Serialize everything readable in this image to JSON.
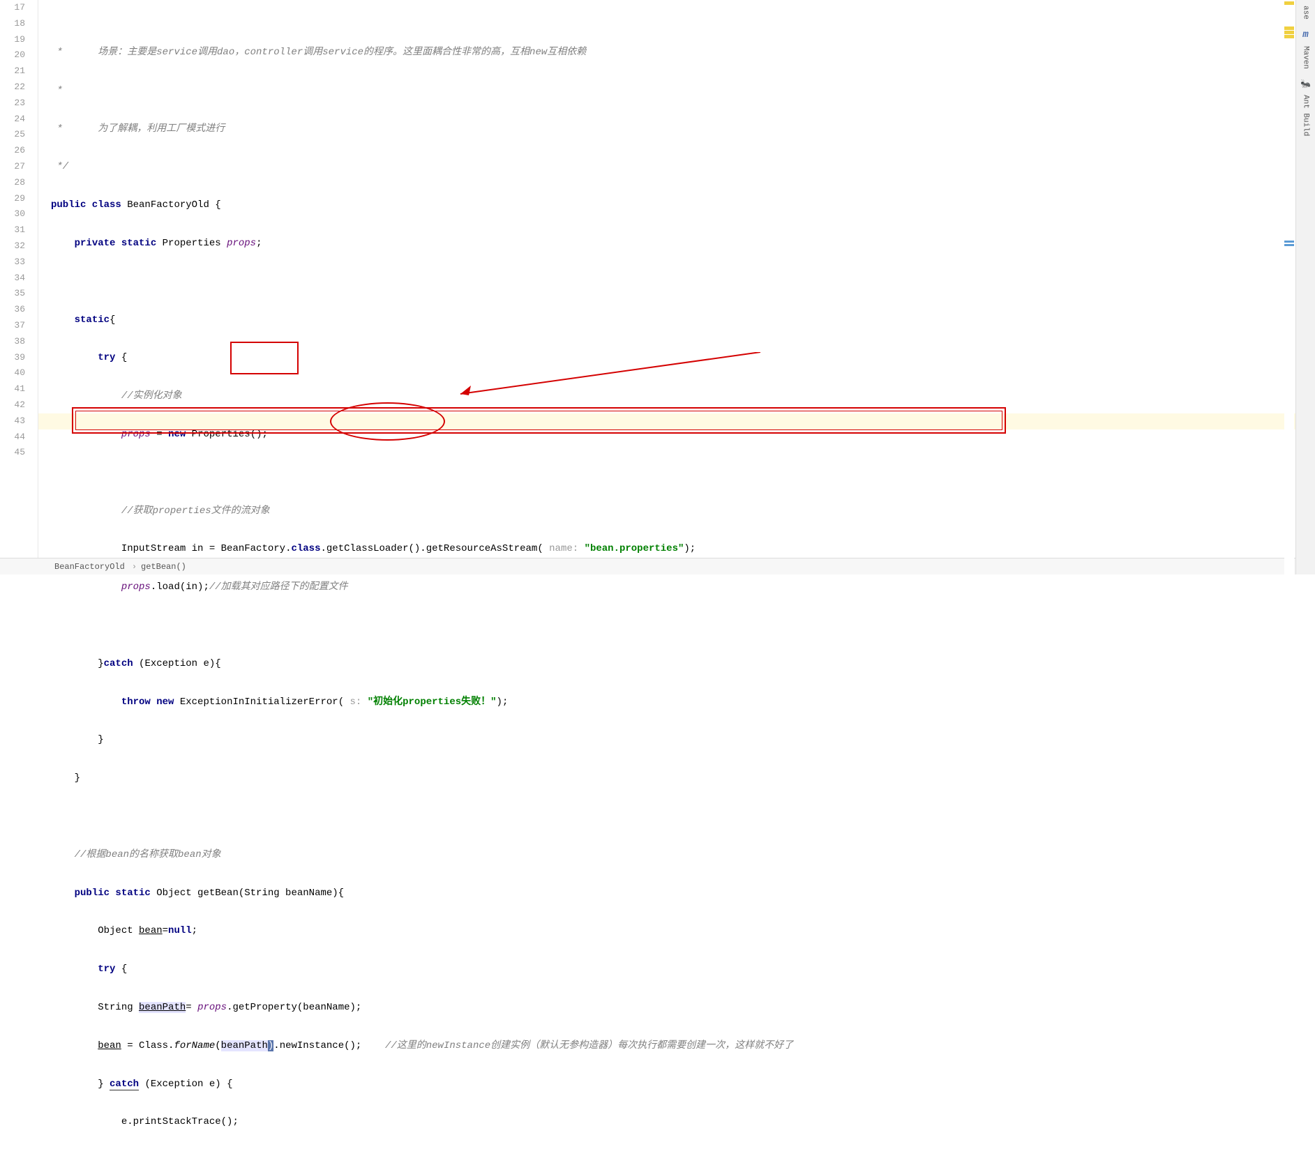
{
  "gutter": {
    "start": 17,
    "end": 45
  },
  "code": {
    "l17_c1": " *      场景：主要是service调用dao，controller调用service的程序。这里面耦合性非常的高，互相new互相依赖",
    "l18_c1": " *",
    "l19_c1": " *      为了解耦，利用工厂模式进行",
    "l20_c1": " */",
    "l21_kw1": "public class",
    "l21_t1": " BeanFactoryOld {",
    "l22_kw1": "private static",
    "l22_t1": " Properties ",
    "l22_f1": "props",
    "l22_t2": ";",
    "l24_kw1": "static",
    "l24_t1": "{",
    "l25_kw1": "try",
    "l25_t1": " {",
    "l26_c1": "//实例化对象",
    "l27_f1": "props",
    "l27_t1": " = ",
    "l27_kw1": "new",
    "l27_t2": " Properties();",
    "l29_c1": "//获取properties文件的流对象",
    "l30_t1": "InputStream in = BeanFactory.",
    "l30_kw1": "class",
    "l30_t2": ".getClassLoader().getResourceAsStream( ",
    "l30_h1": "name: ",
    "l30_s1": "\"bean.properties\"",
    "l30_t3": ");",
    "l31_f1": "props",
    "l31_t1": ".load(in);",
    "l31_c1": "//加载其对应路径下的配置文件",
    "l33_t1": "}",
    "l33_kw1": "catch",
    "l33_t2": " (Exception e){",
    "l34_kw1": "throw new",
    "l34_t1": " ExceptionInInitializerError( ",
    "l34_h1": "s: ",
    "l34_s1": "\"初始化properties失败！\"",
    "l34_t2": ");",
    "l35_t1": "}",
    "l36_t1": "}",
    "l38_c1": "//根据bean的名称获取bean对象",
    "l39_kw1": "public static",
    "l39_t1": " Object getBean(String beanName){",
    "l40_t1": "Object ",
    "l40_u1": "bean",
    "l40_t2": "=",
    "l40_kw1": "null",
    "l40_t3": ";",
    "l41_kw1": "try",
    "l41_t1": " {",
    "l42_t1": "String ",
    "l42_sel1": "beanPath",
    "l42_t2": "= ",
    "l42_f1": "props",
    "l42_t3": ".getProperty(beanName);",
    "l43_u1": "bean",
    "l43_t1": " = Class.",
    "l43_i1": "forName",
    "l43_t2": "(",
    "l43_sel2": "beanPath",
    "l43_sel3": ")",
    "l43_t3": ".newInstance();    ",
    "l43_c1": "//这里的newInstance创建实例（默认无参构造器）每次执行都需要创建一次，这样就不好了",
    "l44_t1": "} ",
    "l44_kw1": "catch",
    "l44_t2": " (Exception e) {",
    "l45_t1": "e.printStackTrace();"
  },
  "breadcrumb": {
    "item1": "BeanFactoryOld",
    "item2": "getBean()"
  },
  "tools": {
    "tab1": "ase",
    "tab2": "Maven",
    "tab3": "Ant Build"
  }
}
